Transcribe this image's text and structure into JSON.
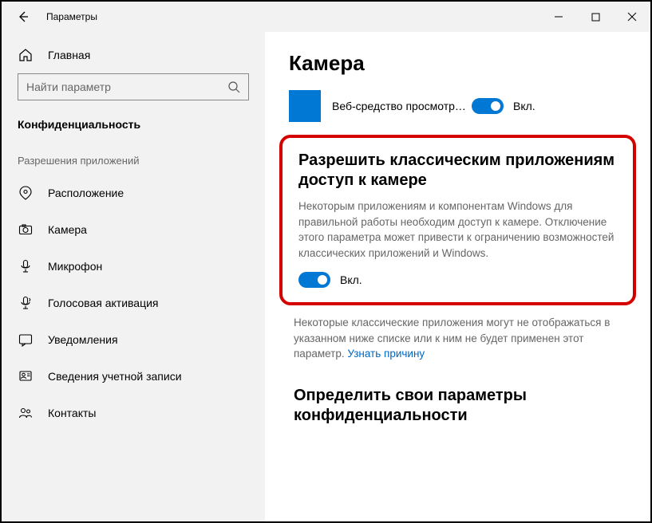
{
  "window": {
    "title": "Параметры"
  },
  "sidebar": {
    "home": "Главная",
    "search_placeholder": "Найти параметр",
    "section": "Конфиденциальность",
    "group": "Разрешения приложений",
    "items": [
      {
        "label": "Расположение"
      },
      {
        "label": "Камера"
      },
      {
        "label": "Микрофон"
      },
      {
        "label": "Голосовая активация"
      },
      {
        "label": "Уведомления"
      },
      {
        "label": "Сведения учетной записи"
      },
      {
        "label": "Контакты"
      }
    ]
  },
  "content": {
    "title": "Камера",
    "app": {
      "name": "Веб-средство просмотра к…",
      "state": "Вкл."
    },
    "classic": {
      "heading": "Разрешить классическим приложениям доступ к камере",
      "desc": "Некоторым приложениям и компонентам Windows для правильной работы необходим доступ к камере. Отключение этого параметра может привести к ограничению возможностей классических приложений и Windows.",
      "state": "Вкл."
    },
    "note": "Некоторые классические приложения могут не отображаться в указанном ниже списке или к ним не будет применен этот параметр. ",
    "note_link": "Узнать причину",
    "bottom_heading": "Определить свои параметры конфиденциальности"
  }
}
